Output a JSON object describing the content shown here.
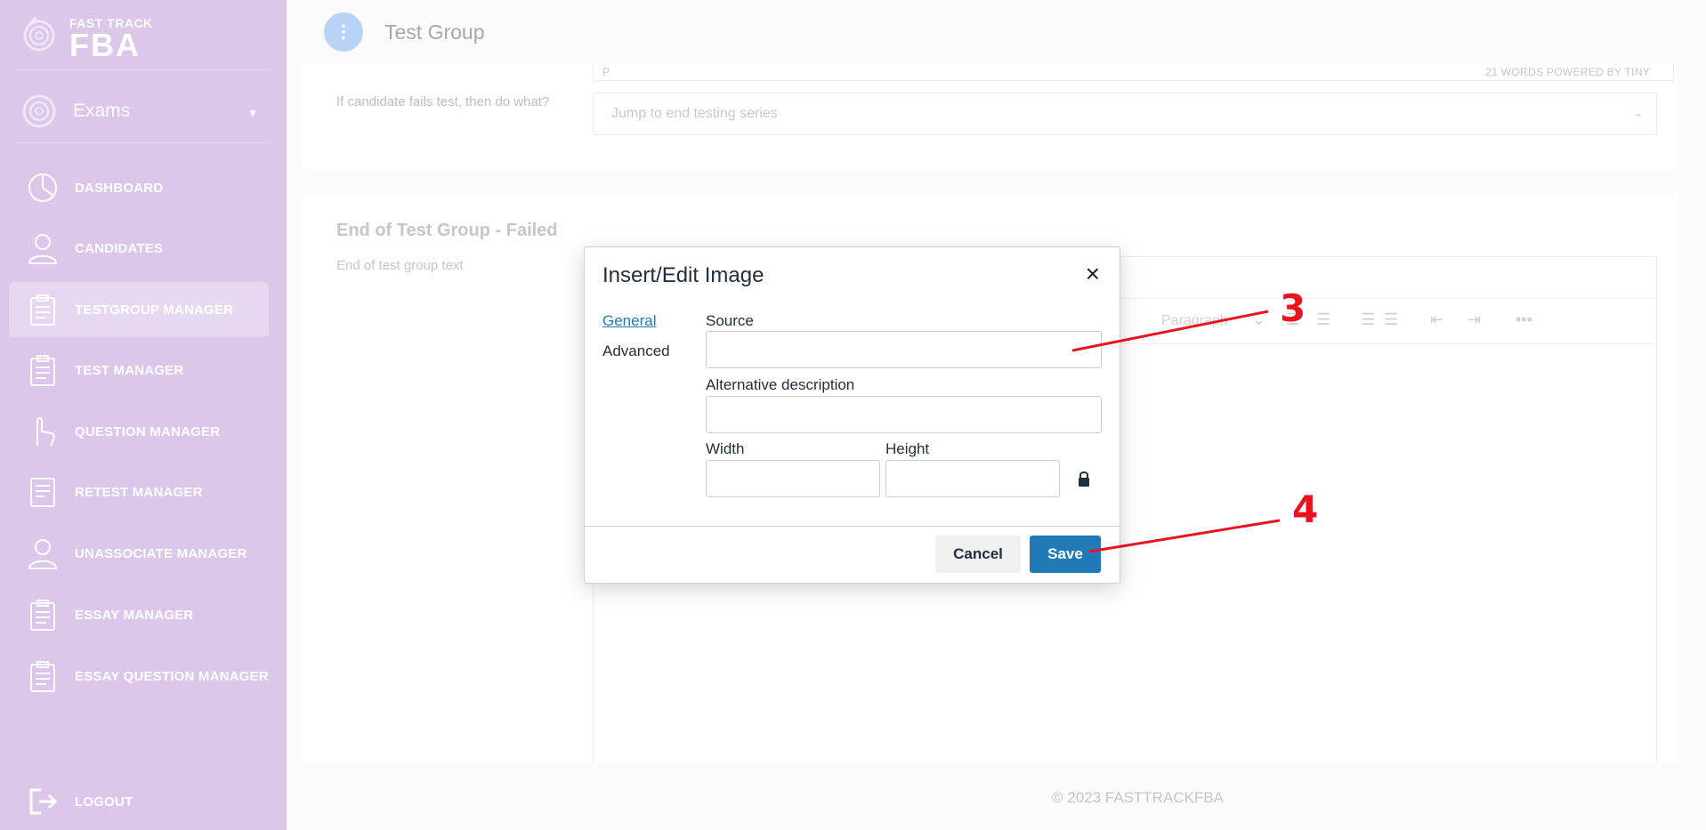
{
  "brand": {
    "small": "FAST TRACK",
    "big": "FBA"
  },
  "sidebar": {
    "section": "Exams",
    "items": [
      {
        "label": "DASHBOARD",
        "icon": "pie-chart-icon"
      },
      {
        "label": "CANDIDATES",
        "icon": "user-icon"
      },
      {
        "label": "TESTGROUP MANAGER",
        "icon": "clipboard-icon",
        "active": true
      },
      {
        "label": "TEST MANAGER",
        "icon": "clipboard-icon"
      },
      {
        "label": "QUESTION MANAGER",
        "icon": "hand-pointer-icon"
      },
      {
        "label": "RETEST MANAGER",
        "icon": "document-icon"
      },
      {
        "label": "UNASSOCIATE MANAGER",
        "icon": "user-icon"
      },
      {
        "label": "ESSAY MANAGER",
        "icon": "clipboard-icon"
      },
      {
        "label": "ESSAY QUESTION MANAGER",
        "icon": "clipboard-icon"
      }
    ],
    "logout": "LOGOUT"
  },
  "header": {
    "dot": "⋮",
    "title": "Test Group"
  },
  "editor_top": {
    "p": "P",
    "words": "21 WORDS  POWERED BY TINY"
  },
  "fail_field": {
    "label": "If candidate fails test, then do what?",
    "value": "Jump to end testing series"
  },
  "section": {
    "title": "End of Test Group - Failed",
    "subtitle": "End of test group text"
  },
  "toolbar": {
    "paragraph": "Paragraph"
  },
  "footer": {
    "text": "© 2023 FASTTRACKFBA"
  },
  "modal": {
    "title": "Insert/Edit Image",
    "close": "×",
    "tabs": {
      "general": "General",
      "advanced": "Advanced"
    },
    "source_label": "Source",
    "source_value": "",
    "alt_label": "Alternative description",
    "alt_value": "",
    "width_label": "Width",
    "width_value": "",
    "height_label": "Height",
    "height_value": "",
    "cancel": "Cancel",
    "save": "Save"
  },
  "annotations": {
    "step3": "3",
    "step4": "4",
    "color": "#e8151f"
  }
}
